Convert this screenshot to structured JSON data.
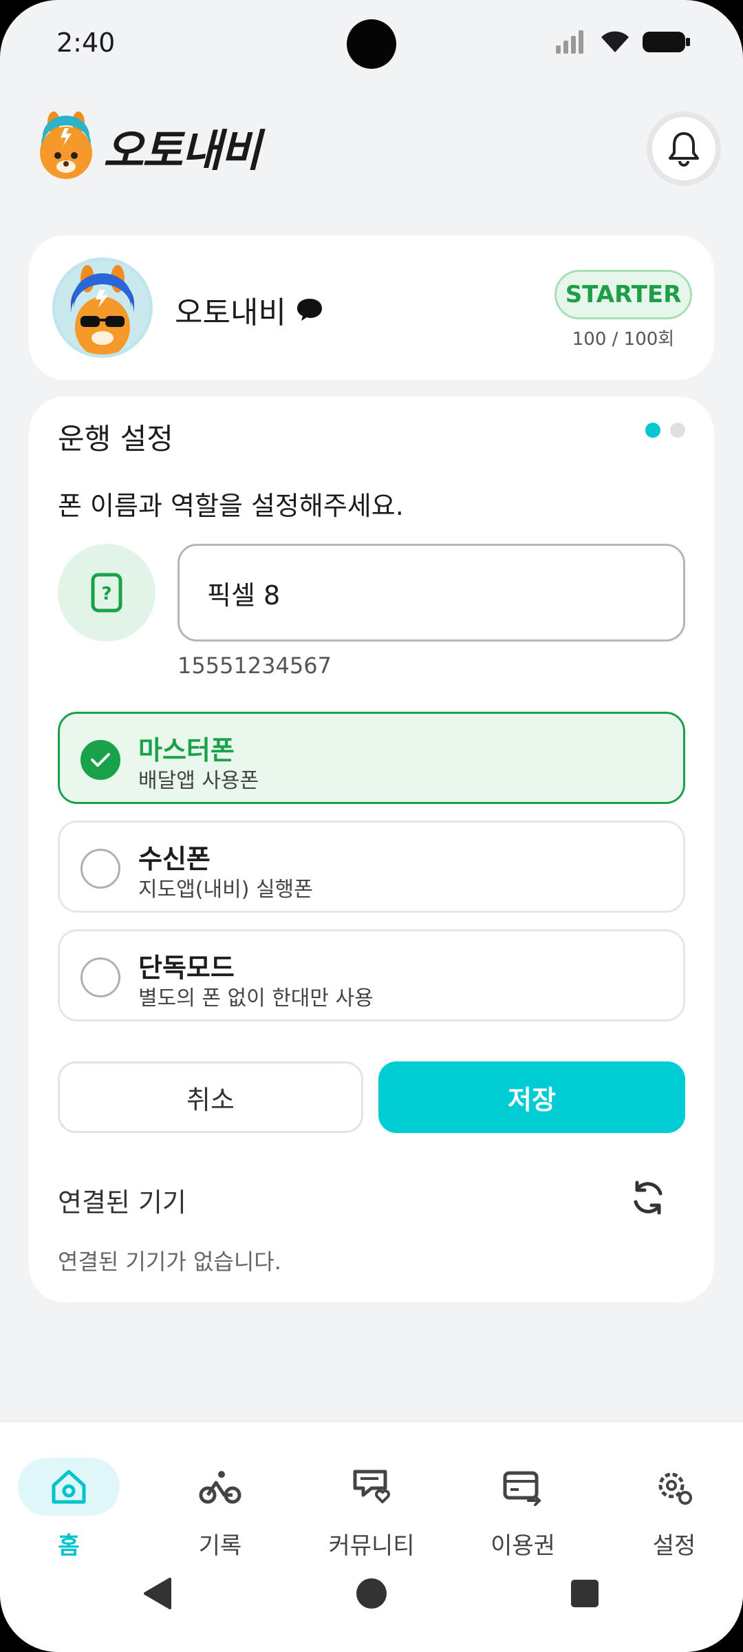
{
  "status_bar": {
    "time": "2:40"
  },
  "header": {
    "app_name": "오토내비"
  },
  "profile": {
    "name": "오토내비",
    "plan": "STARTER",
    "usage": "100 / 100회"
  },
  "settings": {
    "title": "운행 설정",
    "subtitle": "폰 이름과 역할을 설정해주세요.",
    "phone_name_value": "픽셀 8",
    "phone_number": "15551234567",
    "roles": [
      {
        "title": "마스터폰",
        "desc": "배달앱 사용폰",
        "selected": true
      },
      {
        "title": "수신폰",
        "desc": "지도앱(내비) 실행폰",
        "selected": false
      },
      {
        "title": "단독모드",
        "desc": "별도의 폰 없이 한대만 사용",
        "selected": false
      }
    ],
    "cancel_label": "취소",
    "save_label": "저장",
    "devices_title": "연결된 기기",
    "devices_empty": "연결된 기기가 없습니다."
  },
  "nav": {
    "items": [
      {
        "label": "홈",
        "icon": "home-icon",
        "active": true
      },
      {
        "label": "기록",
        "icon": "bicycle-icon",
        "active": false
      },
      {
        "label": "커뮤니티",
        "icon": "message-heart-icon",
        "active": false
      },
      {
        "label": "이용권",
        "icon": "ticket-icon",
        "active": false
      },
      {
        "label": "설정",
        "icon": "gear-icon",
        "active": false
      }
    ]
  },
  "colors": {
    "accent": "#00ccd4",
    "selected_green": "#1aa24a",
    "background": "#f2f3f5"
  }
}
